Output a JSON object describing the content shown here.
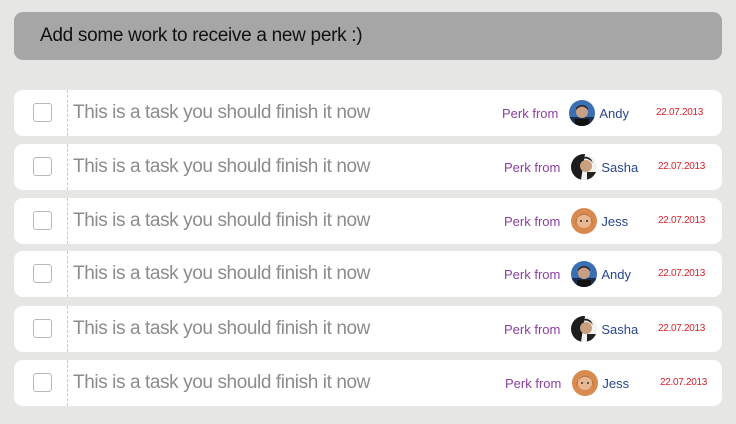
{
  "header": {
    "title": "Add some work to receive a new perk :)"
  },
  "tasks": [
    {
      "text": "This is a task you should finish it now",
      "perk_label": "Perk from",
      "person": "Andy",
      "avatar_icon": "andy-avatar-icon",
      "date": "22.07.2013"
    },
    {
      "text": "This is a task you should finish it now",
      "perk_label": "Perk from",
      "person": "Sasha",
      "avatar_icon": "sasha-avatar-icon",
      "date": "22.07.2013"
    },
    {
      "text": "This is a task you should finish it now",
      "perk_label": "Perk from",
      "person": "Jess",
      "avatar_icon": "jess-avatar-icon",
      "date": "22.07.2013"
    },
    {
      "text": "This is a task you should finish it now",
      "perk_label": "Perk from",
      "person": "Andy",
      "avatar_icon": "andy-avatar-icon",
      "date": "22.07.2013"
    },
    {
      "text": "This is a task you should finish it now",
      "perk_label": "Perk from",
      "person": "Sasha",
      "avatar_icon": "sasha-avatar-icon",
      "date": "22.07.2013"
    },
    {
      "text": "This is a task you should finish it now",
      "perk_label": "Perk from",
      "person": "Jess",
      "avatar_icon": "jess-avatar-icon",
      "date": "22.07.2013"
    }
  ],
  "colors": {
    "background": "#e6e6e4",
    "header": "#a6a6a6",
    "perk_label": "#8b3fa3",
    "person_name": "#27468d",
    "date": "#d2232a"
  }
}
